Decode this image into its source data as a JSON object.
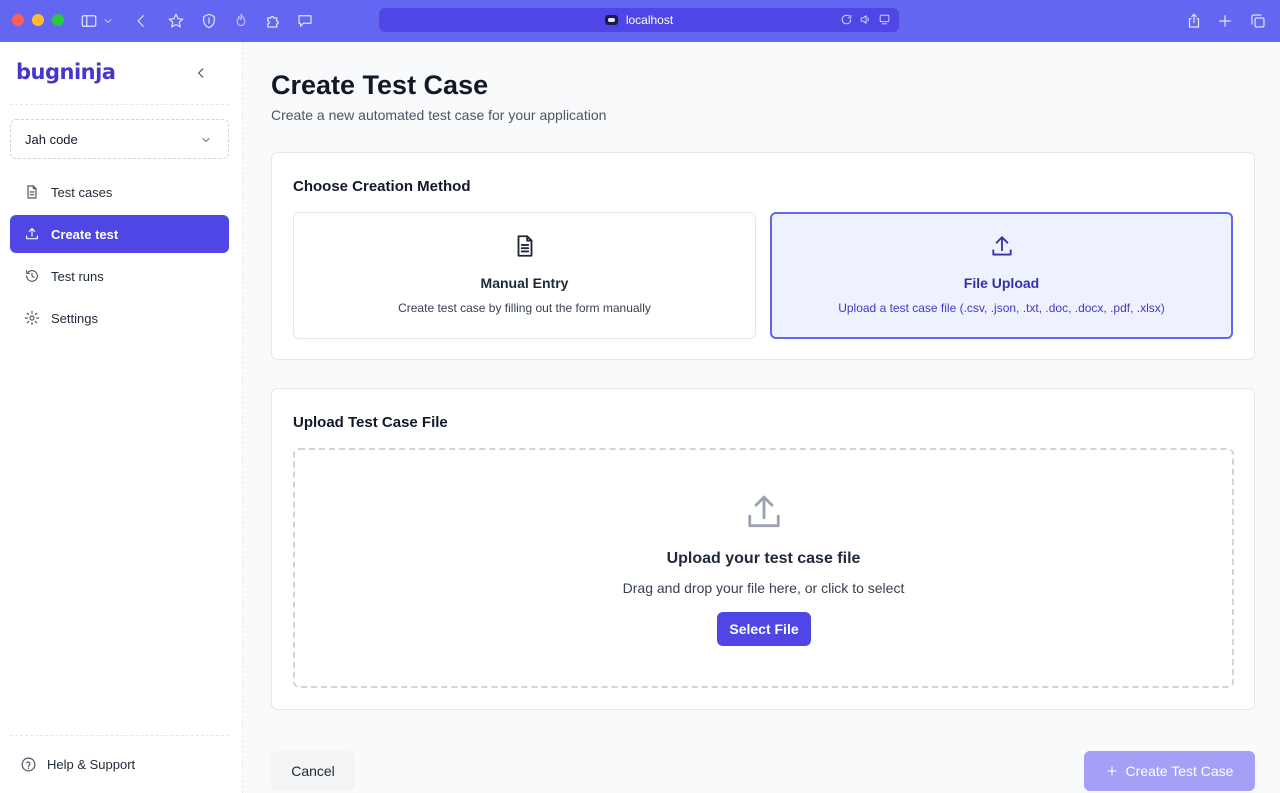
{
  "browser": {
    "url": "localhost",
    "accent": "#6366f1"
  },
  "sidebar": {
    "logo": "bugninja",
    "project": "Jah code",
    "items": [
      {
        "label": "Test cases",
        "icon": "file-text-icon",
        "active": false
      },
      {
        "label": "Create test",
        "icon": "upload-icon",
        "active": true
      },
      {
        "label": "Test runs",
        "icon": "history-icon",
        "active": false
      },
      {
        "label": "Settings",
        "icon": "gear-icon",
        "active": false
      }
    ],
    "help": "Help & Support"
  },
  "page": {
    "title": "Create Test Case",
    "subtitle": "Create a new automated test case for your application"
  },
  "creation_method": {
    "title": "Choose Creation Method",
    "selected": "File Upload",
    "options": [
      {
        "title": "Manual Entry",
        "description": "Create test case by filling out the form manually",
        "icon": "document-icon"
      },
      {
        "title": "File Upload",
        "description": "Upload a test case file (.csv, .json, .txt, .doc, .docx, .pdf, .xlsx)",
        "icon": "upload-icon"
      }
    ]
  },
  "upload": {
    "title": "Upload Test Case File",
    "dropzone_title": "Upload your test case file",
    "dropzone_text": "Drag and drop your file here, or click to select",
    "select_button": "Select File"
  },
  "footer": {
    "cancel": "Cancel",
    "create": "Create Test Case"
  },
  "colors": {
    "primary": "#4f46e5",
    "primary_disabled": "#a5a0f6",
    "selected_bg": "#eef2ff"
  }
}
